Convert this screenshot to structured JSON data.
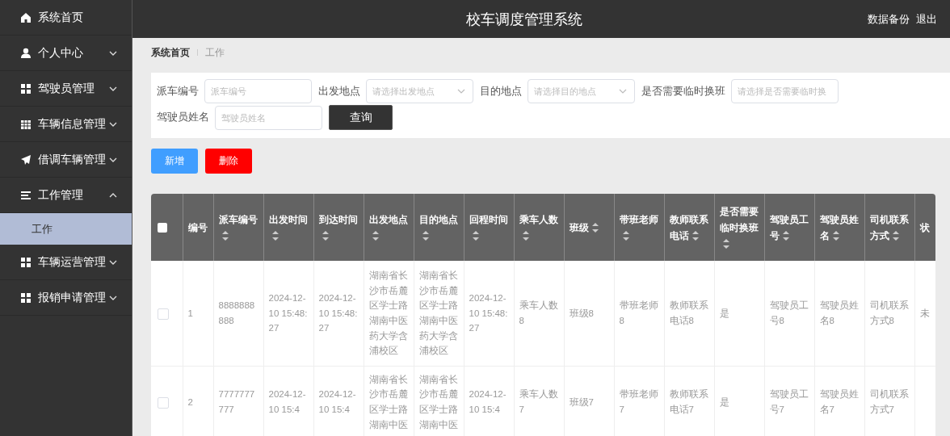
{
  "sidebar": {
    "items": [
      {
        "kind": "link",
        "label": "系统首页"
      },
      {
        "kind": "menu",
        "label": "个人中心",
        "expanded": false
      },
      {
        "kind": "menu",
        "label": "驾驶员管理",
        "expanded": false
      },
      {
        "kind": "menu",
        "label": "车辆信息管理",
        "expanded": false
      },
      {
        "kind": "menu",
        "label": "借调车辆管理",
        "expanded": false
      },
      {
        "kind": "menu",
        "label": "工作管理",
        "expanded": true,
        "children": [
          {
            "label": "工作",
            "selected": true
          }
        ]
      },
      {
        "kind": "menu",
        "label": "车辆运营管理",
        "expanded": false
      },
      {
        "kind": "menu",
        "label": "报销申请管理",
        "expanded": false
      }
    ]
  },
  "topbar": {
    "title": "校车调度管理系统",
    "actions": [
      "数据备份",
      "退出"
    ]
  },
  "breadcrumb": [
    "系统首页",
    "工作"
  ],
  "search": {
    "fields": [
      {
        "kind": "input",
        "label": "派车编号",
        "placeholder": "派车编号"
      },
      {
        "kind": "select",
        "label": "出发地点",
        "placeholder": "请选择出发地点"
      },
      {
        "kind": "select",
        "label": "目的地点",
        "placeholder": "请选择目的地点"
      },
      {
        "kind": "input",
        "label": "是否需要临时换班",
        "placeholder": "请选择是否需要临时换"
      },
      {
        "kind": "input",
        "label": "驾驶员姓名",
        "placeholder": "驾驶员姓名"
      }
    ],
    "button": "查询"
  },
  "actions": [
    {
      "kind": "primary",
      "label": "新增"
    },
    {
      "kind": "danger",
      "label": "删除"
    }
  ],
  "table": {
    "all_checked": false,
    "columns": [
      {
        "label": "编号",
        "sortable": false
      },
      {
        "label": "派车编号",
        "sortable": true
      },
      {
        "label": "出发时间",
        "sortable": true
      },
      {
        "label": "到达时间",
        "sortable": true
      },
      {
        "label": "出发地点",
        "sortable": true
      },
      {
        "label": "目的地点",
        "sortable": true
      },
      {
        "label": "回程时间",
        "sortable": true
      },
      {
        "label": "乘车人数",
        "sortable": true
      },
      {
        "label": "班级",
        "sortable": true
      },
      {
        "label": "带班老师",
        "sortable": true
      },
      {
        "label": "教师联系电话",
        "sortable": true
      },
      {
        "label": "是否需要临时换班",
        "sortable": true
      },
      {
        "label": "驾驶员工号",
        "sortable": true
      },
      {
        "label": "驾驶员姓名",
        "sortable": true
      },
      {
        "label": "司机联系方式",
        "sortable": true
      },
      {
        "label": "状",
        "sortable": false
      }
    ],
    "rows": [
      {
        "checked": false,
        "cells": [
          "1",
          "8888888888",
          "2024-12-10 15:48:27",
          "2024-12-10 15:48:27",
          "湖南省长沙市岳麓区学士路湖南中医药大学含浦校区",
          "湖南省长沙市岳麓区学士路湖南中医药大学含浦校区",
          "2024-12-10 15:48:27",
          "乘车人数8",
          "班级8",
          "带班老师8",
          "教师联系电话8",
          "是",
          "驾驶员工号8",
          "驾驶员姓名8",
          "司机联系方式8",
          "未"
        ]
      },
      {
        "checked": false,
        "cells": [
          "2",
          "7777777777",
          "2024-12-10 15:4",
          "2024-12-10 15:4",
          "湖南省长沙市岳麓区学士路湖南中医",
          "湖南省长沙市岳麓区学士路湖南中医",
          "2024-12-10 15:4",
          "乘车人数7",
          "班级7",
          "带班老师7",
          "教师联系电话7",
          "是",
          "驾驶员工号7",
          "驾驶员姓名7",
          "司机联系方式7"
        ]
      }
    ]
  }
}
